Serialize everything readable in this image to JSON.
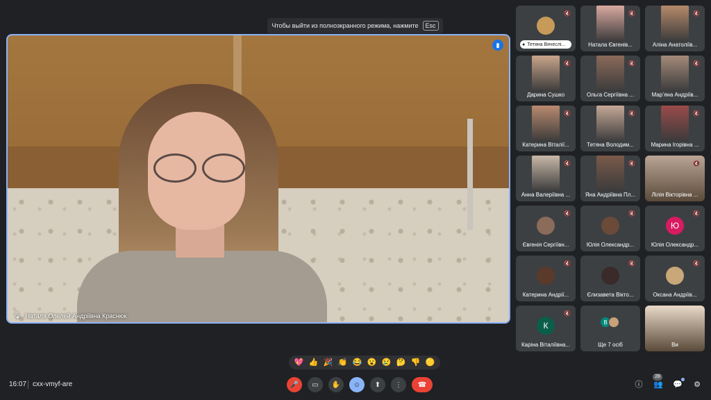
{
  "banner": {
    "text": "Чтобы выйти из полноэкранного режима, нажмите",
    "key": "Esc"
  },
  "main": {
    "speaker_name": "Наталя Олелей Андріївна Краснюк"
  },
  "participants": [
    {
      "name": "Тетяна Вячеслі...",
      "kind": "chip",
      "color": "#c79a5a"
    },
    {
      "name": "Натала Євгенів...",
      "kind": "photo",
      "color": "#d9a9a0"
    },
    {
      "name": "Аліна Анатоліїв...",
      "kind": "photo",
      "color": "#b58a6a"
    },
    {
      "name": "Дарина Сушко",
      "kind": "photo",
      "color": "#c9a48a"
    },
    {
      "name": "Ольга Сергіївна ...",
      "kind": "photo",
      "color": "#8a6a5a"
    },
    {
      "name": "Марʼяна Андріїв...",
      "kind": "photo",
      "color": "#a48a7a"
    },
    {
      "name": "Катерина Віталії...",
      "kind": "photo",
      "color": "#b98a6f"
    },
    {
      "name": "Тетяна Володим...",
      "kind": "photo",
      "color": "#c4a896"
    },
    {
      "name": "Марина Ігорівна ...",
      "kind": "photo",
      "color": "#9a4a4a"
    },
    {
      "name": "Анна Валеріївна ...",
      "kind": "photo",
      "color": "#c8b8a8"
    },
    {
      "name": "Яна Андріївна Пл...",
      "kind": "photo",
      "color": "#7a5a4a"
    },
    {
      "name": "Лілія Вікторівна ...",
      "kind": "wide",
      "color": "#b9a495"
    },
    {
      "name": "Євгенія Сергіївн...",
      "kind": "avatar",
      "color": "#8b6b5a"
    },
    {
      "name": "Юлія Олександр...",
      "kind": "avatar",
      "color": "#6b4a3a"
    },
    {
      "name": "Юлія Олександр...",
      "kind": "letter",
      "letter": "Ю",
      "color": "#d81b60"
    },
    {
      "name": "Катерина Андрії...",
      "kind": "avatar",
      "color": "#5a3a2a"
    },
    {
      "name": "Єлизавета Вікто...",
      "kind": "avatar",
      "color": "#3a2a2a"
    },
    {
      "name": "Оксана Андріїв...",
      "kind": "avatar",
      "color": "#c8a878"
    },
    {
      "name": "Каріна Віталіївна...",
      "kind": "letter",
      "letter": "К",
      "color": "#0b5e4a"
    },
    {
      "name": "Ще 7 осіб",
      "kind": "more",
      "letter": "В",
      "color": "#00897b"
    },
    {
      "name": "Ви",
      "kind": "wide",
      "color": "#e9d9c8"
    }
  ],
  "reactions": [
    "💖",
    "👍",
    "🎉",
    "👏",
    "😂",
    "😮",
    "😢",
    "🤔",
    "👎",
    "🟡"
  ],
  "footer": {
    "time": "16:07",
    "meeting_code": "cxx-vmyf-are",
    "people_count": "28"
  },
  "controls": {
    "mic": "🎤",
    "camera": "▭",
    "hand": "✋",
    "emoji": "☺",
    "present": "⬆",
    "more": "⋮",
    "hangup": "☎"
  },
  "right_icons": {
    "info": "ⓘ",
    "people": "👥",
    "chat": "💬",
    "activities": "⚙"
  },
  "colors": {
    "accent": "#8ab4f8",
    "danger": "#ea4335",
    "background": "#202124"
  }
}
